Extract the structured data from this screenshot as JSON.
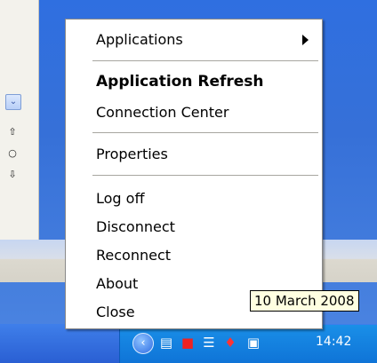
{
  "menu": {
    "applications": "Applications",
    "application_refresh": "Application Refresh",
    "connection_center": "Connection Center",
    "properties": "Properties",
    "log_off": "Log off",
    "disconnect": "Disconnect",
    "reconnect": "Reconnect",
    "about": "About",
    "close": "Close"
  },
  "tooltip": {
    "date": "10 March 2008"
  },
  "tray": {
    "time": "14:42",
    "icons": [
      "show-hidden-icons-chevron-icon",
      "network-icon",
      "citrix-receiver-icon",
      "shield-icon",
      "security-icon",
      "computer-network-icon"
    ]
  },
  "side_window": {
    "icons": [
      "chevron-down-icon",
      "move-up-icon",
      "circle-icon",
      "move-down-icon"
    ]
  },
  "colors": {
    "desktop": "#3670d8",
    "taskbar": "#2a5fd3",
    "tray": "#0f74d7",
    "tooltip_bg": "#ffffe1"
  }
}
